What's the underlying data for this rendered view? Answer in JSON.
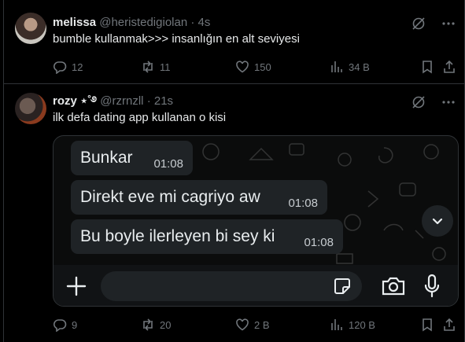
{
  "tweets": [
    {
      "name": "melissa",
      "handle": "@heristedigiolan",
      "separator": "·",
      "time": "4s",
      "text": "bumble kullanmak>>> insanlığın en alt seviyesi",
      "stats": {
        "replies": "12",
        "reposts": "11",
        "likes": "150",
        "views": "34 B"
      }
    },
    {
      "name": "rozy ⋆˚࿔",
      "handle": "@rzrnzll",
      "separator": "·",
      "time": "21s",
      "text": "ilk defa dating app kullanan o kisi",
      "stats": {
        "replies": "9",
        "reposts": "20",
        "likes": "2 B",
        "views": "120 B"
      },
      "media": {
        "messages": [
          {
            "text": "Bunkar",
            "time": "01:08"
          },
          {
            "text": "Direkt eve mi cagriyo aw",
            "time": "01:08"
          },
          {
            "text": "Bu boyle ilerleyen bi sey ki",
            "time": "01:08"
          }
        ]
      }
    }
  ],
  "icons": {
    "grok": "grok-icon",
    "more": "more-icon",
    "reply": "reply-icon",
    "repost": "repost-icon",
    "like": "heart-icon",
    "views": "views-chart-icon",
    "bookmark": "bookmark-icon",
    "share": "share-icon",
    "chevron": "chevron-down-icon",
    "plus": "plus-icon",
    "sticker": "sticker-icon",
    "camera": "camera-icon",
    "mic": "microphone-icon"
  },
  "colors": {
    "background": "#000000",
    "text": "#e7e9ea",
    "muted": "#71767b",
    "border": "#2f3336",
    "bubble": "#1f2326"
  }
}
